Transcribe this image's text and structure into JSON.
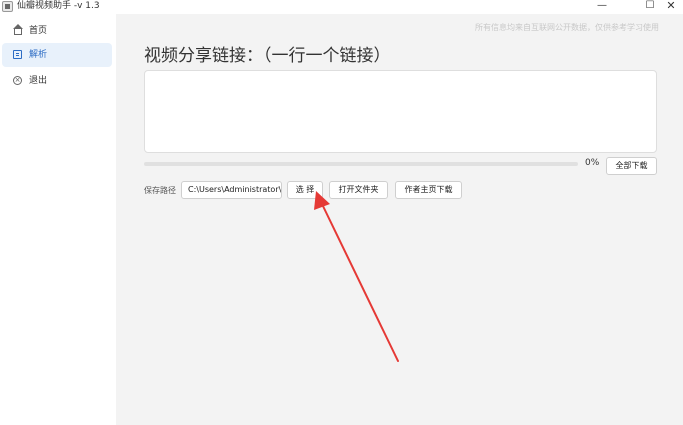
{
  "window": {
    "title": "仙瓣视频助手 -v 1.3",
    "minimize": "—",
    "maximize": "☐",
    "close": "✕"
  },
  "sidebar": {
    "items": [
      {
        "label": "首页",
        "icon": "home-icon",
        "active": false
      },
      {
        "label": "解析",
        "icon": "document-icon",
        "active": true
      },
      {
        "label": "退出",
        "icon": "exit-icon",
        "active": false
      }
    ]
  },
  "main": {
    "disclaimer": "所有信息均来自互联网公开数据，仅供参考学习使用",
    "heading": "视频分享链接：（一行一个链接）",
    "link_input_value": "",
    "progress": {
      "value": 0,
      "text": "0%"
    },
    "download_all_label": "全部下载",
    "save_path_label": "保存路径",
    "save_path_value": "C:\\Users\\Administrator\\D",
    "select_label": "选 择",
    "open_folder_label": "打开文件夹",
    "author_download_label": "作者主页下载"
  },
  "colors": {
    "accent": "#2c6cc4",
    "arrow": "#e53935",
    "main_bg": "#f3f3f3"
  }
}
